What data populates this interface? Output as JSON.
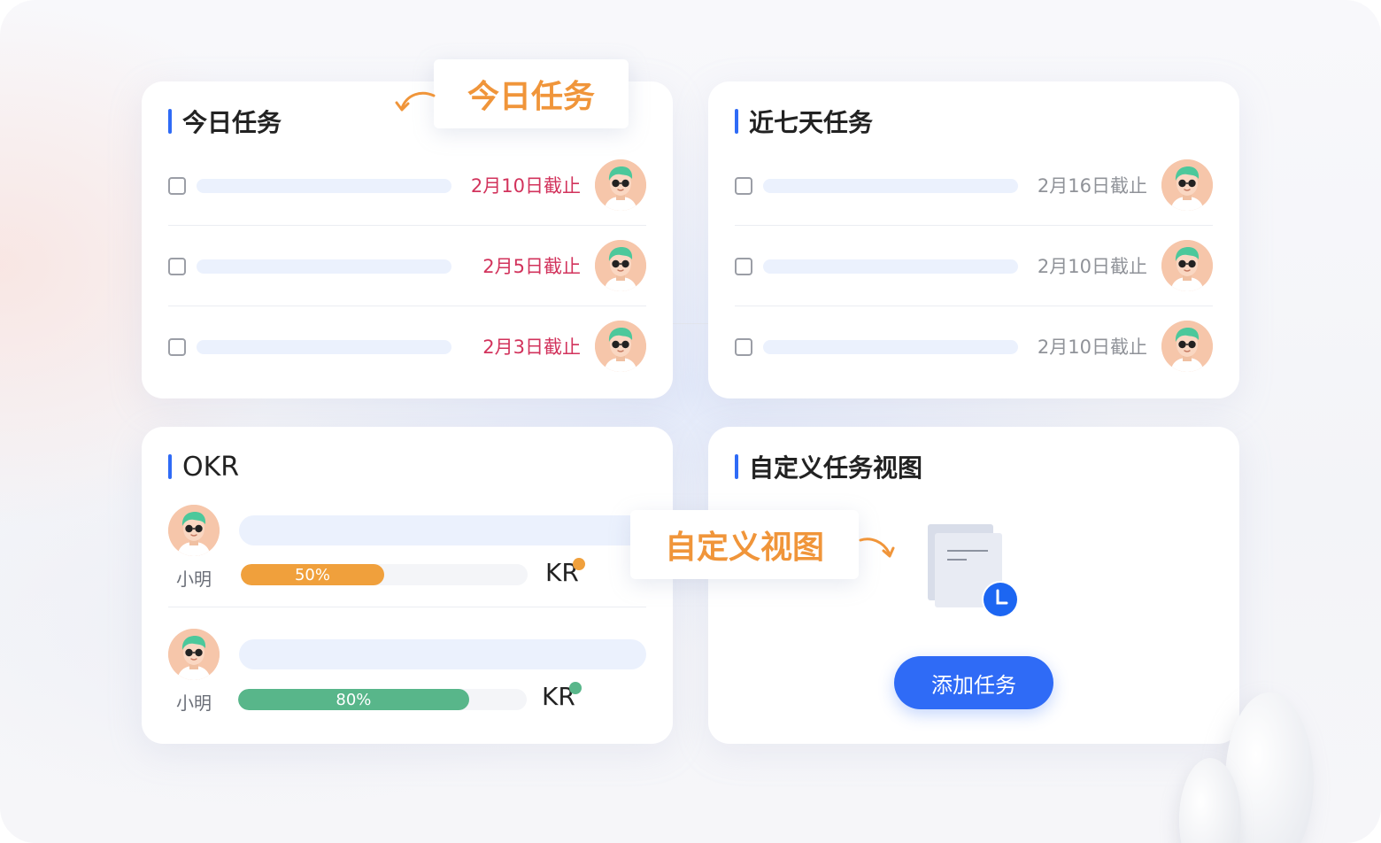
{
  "callouts": {
    "today": "今日任务",
    "custom": "自定义视图"
  },
  "today_card": {
    "title": "今日任务",
    "tasks": [
      {
        "deadline": "2月10日截止"
      },
      {
        "deadline": "2月5日截止"
      },
      {
        "deadline": "2月3日截止"
      }
    ]
  },
  "week_card": {
    "title": "近七天任务",
    "tasks": [
      {
        "deadline": "2月16日截止"
      },
      {
        "deadline": "2月10日截止"
      },
      {
        "deadline": "2月10日截止"
      }
    ]
  },
  "okr_card": {
    "title": "OKR",
    "items": [
      {
        "name": "小明",
        "progress_label": "50%",
        "progress": 0.5,
        "color": "#f0a03c",
        "kr": "KR"
      },
      {
        "name": "小明",
        "progress_label": "80%",
        "progress": 0.8,
        "color": "#58b68a",
        "kr": "KR"
      }
    ]
  },
  "custom_card": {
    "title": "自定义任务视图",
    "add_button": "添加任务"
  },
  "colors": {
    "accent": "#2f6bf6",
    "deadline_urgent": "#d2335c",
    "deadline_normal": "#909399",
    "callout_text": "#f0953a"
  },
  "icons": [
    "checkbox-icon",
    "avatar-icon",
    "document-icon",
    "clock-icon",
    "curved-arrow-icon"
  ]
}
